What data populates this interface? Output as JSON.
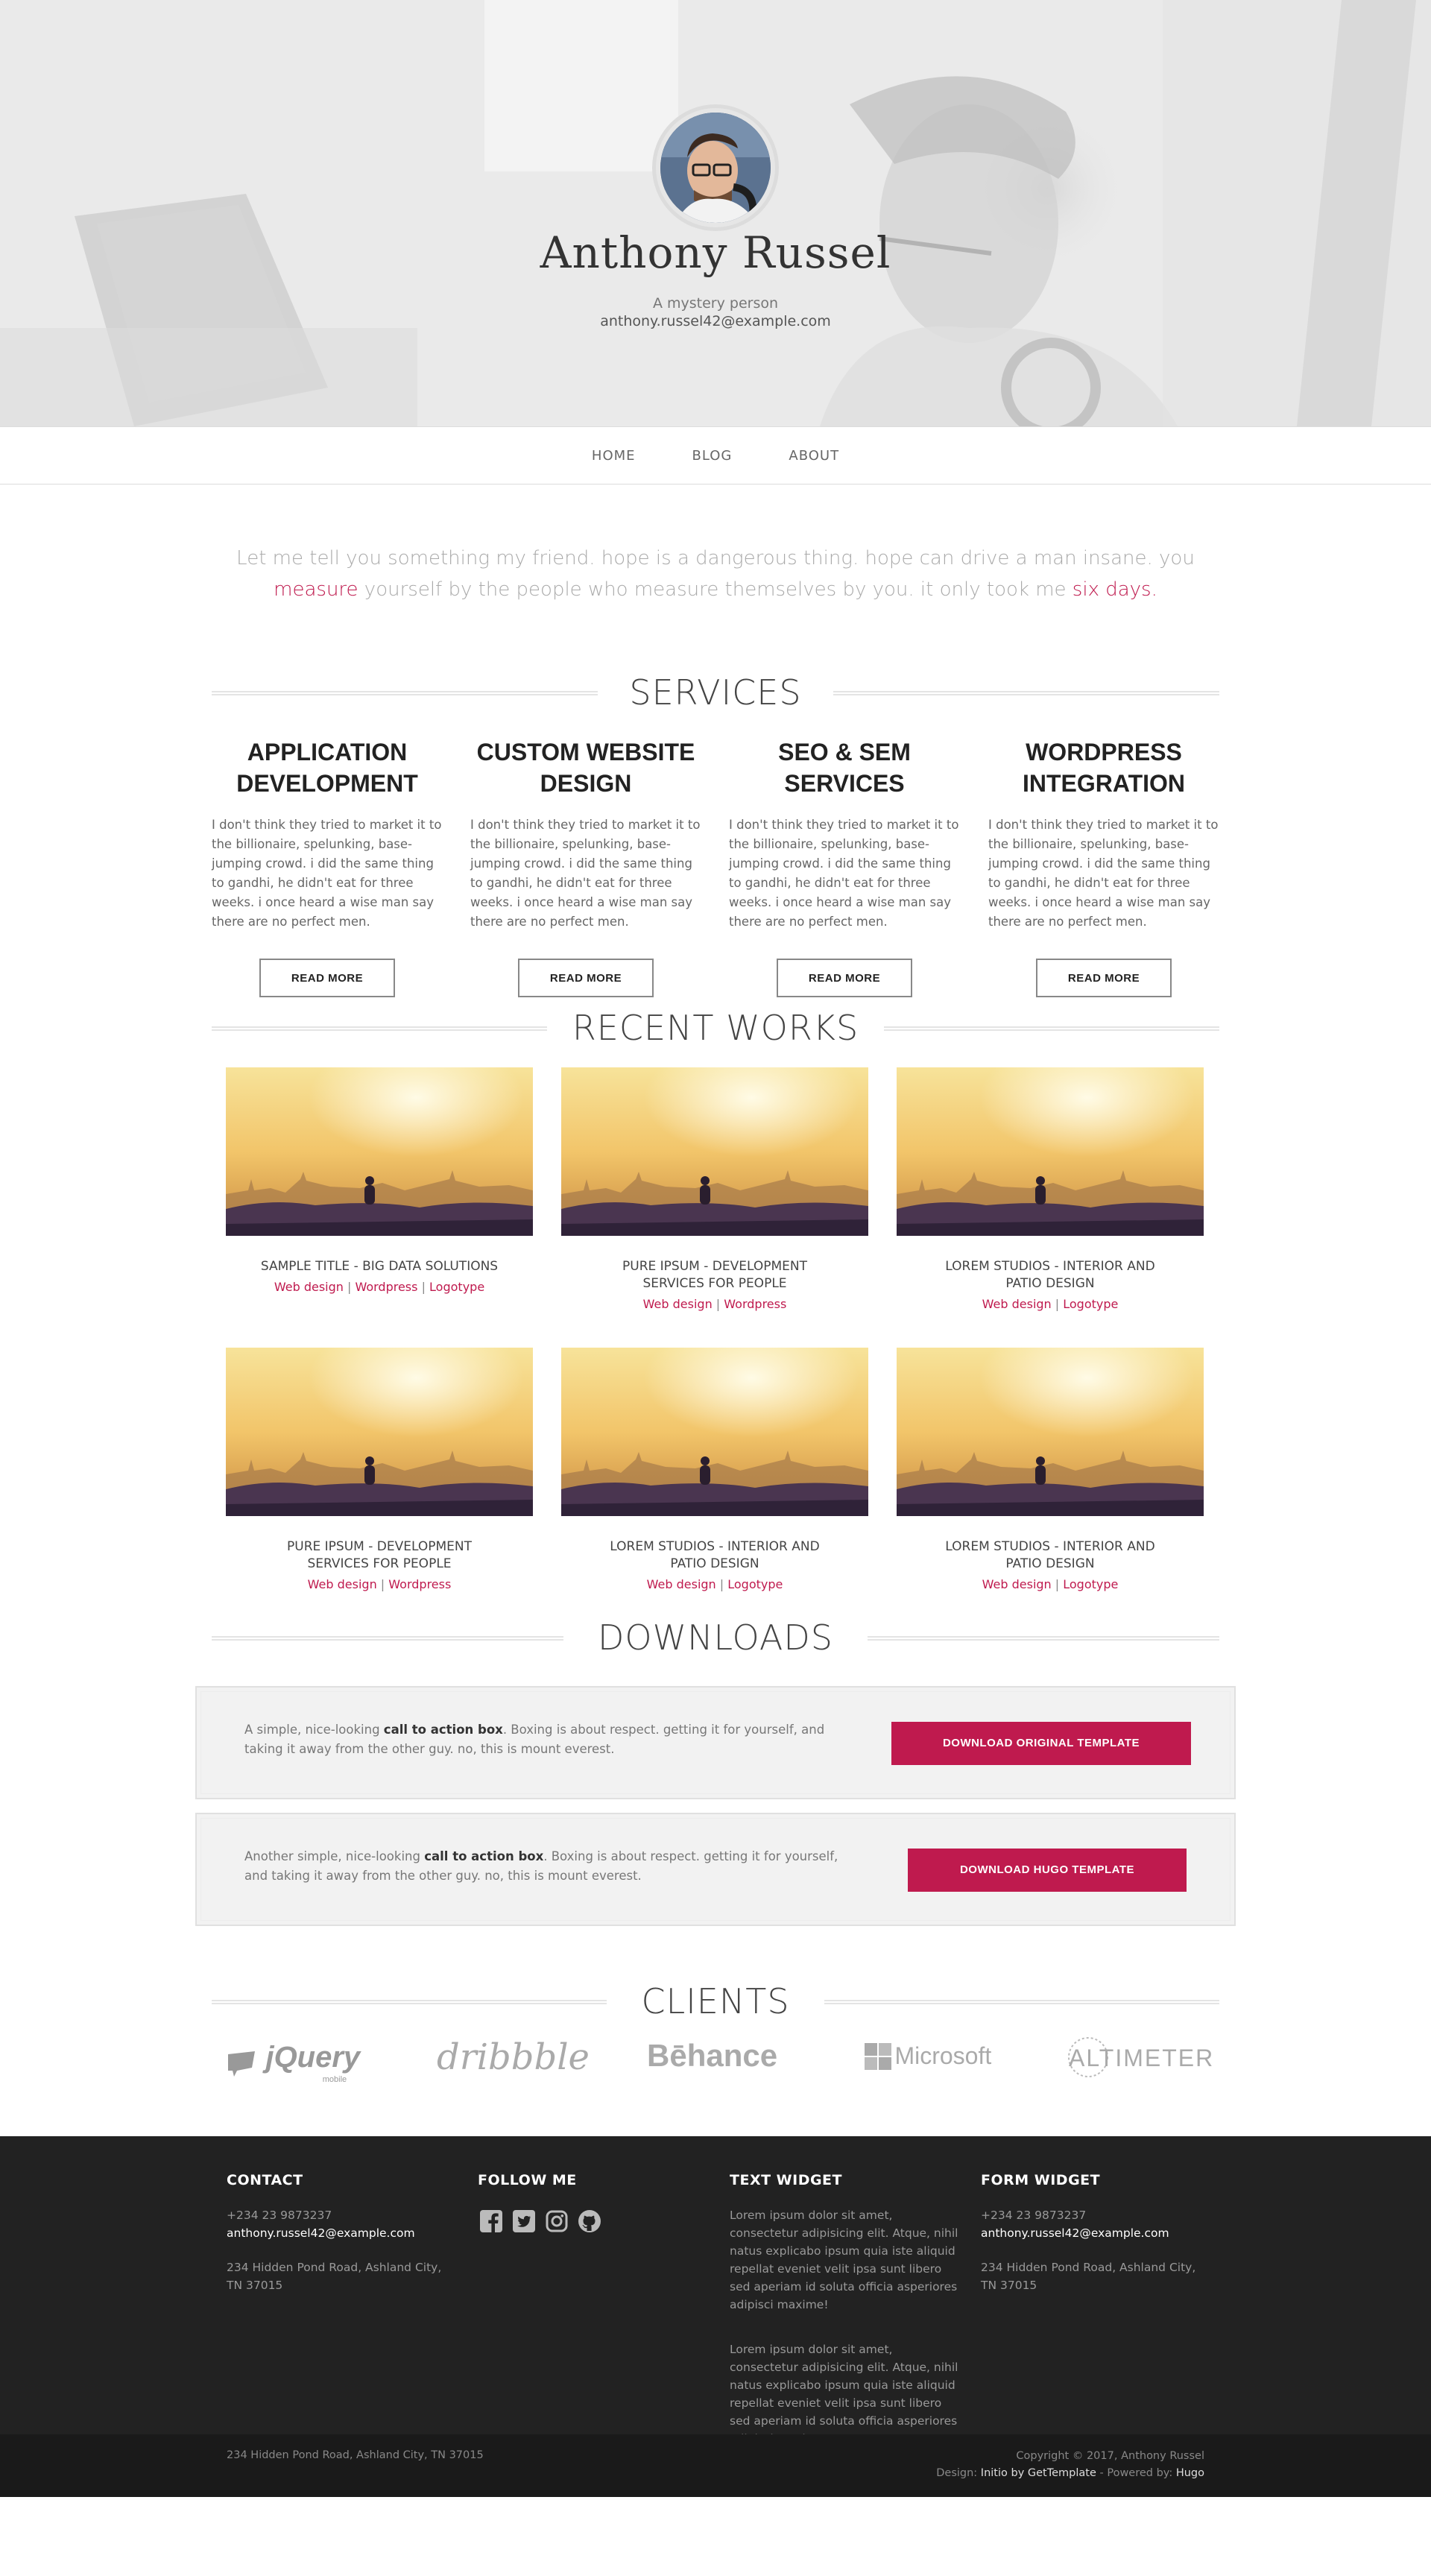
{
  "hero": {
    "name": "Anthony Russel",
    "tagline": "A mystery person",
    "email": "anthony.russel42@example.com"
  },
  "nav": {
    "items": [
      {
        "label": "HOME"
      },
      {
        "label": "BLOG"
      },
      {
        "label": "ABOUT"
      }
    ]
  },
  "intro": {
    "part1": "Let me tell you something my friend. hope is a dangerous thing. hope can drive a man insane. you ",
    "link1": "measure",
    "part2": " yourself by the people who measure themselves by you. it only took me ",
    "link2": "six days",
    "part3": "."
  },
  "services": {
    "title": "SERVICES",
    "items": [
      {
        "title": "APPLICATION DEVELOPMENT",
        "text": "I don't think they tried to market it to the billionaire, spelunking, base-jumping crowd. i did the same thing to gandhi, he didn't eat for three weeks. i once heard a wise man say there are no perfect men.",
        "button": "READ MORE"
      },
      {
        "title": "CUSTOM WEBSITE DESIGN",
        "text": "I don't think they tried to market it to the billionaire, spelunking, base-jumping crowd. i did the same thing to gandhi, he didn't eat for three weeks. i once heard a wise man say there are no perfect men.",
        "button": "READ MORE"
      },
      {
        "title": "SEO & SEM SERVICES",
        "text": "I don't think they tried to market it to the billionaire, spelunking, base-jumping crowd. i did the same thing to gandhi, he didn't eat for three weeks. i once heard a wise man say there are no perfect men.",
        "button": "READ MORE"
      },
      {
        "title": "WORDPRESS INTEGRATION",
        "text": "I don't think they tried to market it to the billionaire, spelunking, base-jumping crowd. i did the same thing to gandhi, he didn't eat for three weeks. i once heard a wise man say there are no perfect men.",
        "button": "READ MORE"
      }
    ]
  },
  "works": {
    "title": "RECENT WORKS",
    "items": [
      {
        "title": "SAMPLE TITLE - BIG DATA SOLUTIONS",
        "tags": [
          "Web design",
          "Wordpress",
          "Logotype"
        ]
      },
      {
        "title": "PURE IPSUM - DEVELOPMENT SERVICES FOR PEOPLE",
        "tags": [
          "Web design",
          "Wordpress"
        ]
      },
      {
        "title": "LOREM STUDIOS - INTERIOR AND PATIO DESIGN",
        "tags": [
          "Web design",
          "Logotype"
        ]
      },
      {
        "title": "PURE IPSUM - DEVELOPMENT SERVICES FOR PEOPLE",
        "tags": [
          "Web design",
          "Wordpress"
        ]
      },
      {
        "title": "LOREM STUDIOS - INTERIOR AND PATIO DESIGN",
        "tags": [
          "Web design",
          "Logotype"
        ]
      },
      {
        "title": "LOREM STUDIOS - INTERIOR AND PATIO DESIGN",
        "tags": [
          "Web design",
          "Logotype"
        ]
      }
    ]
  },
  "downloads": {
    "title": "DOWNLOADS",
    "boxes": [
      {
        "pre": "A simple, nice-looking ",
        "bold": "call to action box",
        "post": ". Boxing is about respect. getting it for yourself, and taking it away from the other guy. no, this is mount everest.",
        "button": "DOWNLOAD ORIGINAL TEMPLATE"
      },
      {
        "pre": "Another simple, nice-looking ",
        "bold": "call to action box",
        "post": ". Boxing is about respect. getting it for yourself, and taking it away from the other guy. no, this is mount everest.",
        "button": "DOWNLOAD HUGO TEMPLATE"
      }
    ]
  },
  "clients": {
    "title": "CLIENTS",
    "logos": [
      {
        "main": "jQuery",
        "sub": "mobile",
        "icon": "jquery-mobile-logo"
      },
      {
        "main": "dribbble",
        "icon": "dribbble-logo"
      },
      {
        "main": "Bēhance",
        "icon": "behance-logo"
      },
      {
        "main": "Microsoft",
        "icon": "microsoft-logo"
      },
      {
        "main": "ALTIMETER",
        "icon": "altimeter-logo"
      }
    ]
  },
  "footer": {
    "contact": {
      "heading": "CONTACT",
      "phone": "+234 23 9873237",
      "email": "anthony.russel42@example.com",
      "address": "234 Hidden Pond Road, Ashland City, TN 37015"
    },
    "follow": {
      "heading": "FOLLOW ME",
      "icons": [
        "facebook-icon",
        "twitter-icon",
        "instagram-icon",
        "github-icon"
      ]
    },
    "text_widget": {
      "heading": "TEXT WIDGET",
      "paragraphs": [
        "Lorem ipsum dolor sit amet, consectetur adipisicing elit. Atque, nihil natus explicabo ipsum quia iste aliquid repellat eveniet velit ipsa sunt libero sed aperiam id soluta officia asperiores adipisci maxime!",
        "Lorem ipsum dolor sit amet, consectetur adipisicing elit. Atque, nihil natus explicabo ipsum quia iste aliquid repellat eveniet velit ipsa sunt libero sed aperiam id soluta officia asperiores adipisci maxime!"
      ]
    },
    "form_widget": {
      "heading": "FORM WIDGET",
      "phone": "+234 23 9873237",
      "email": "anthony.russel42@example.com",
      "address": "234 Hidden Pond Road, Ashland City, TN 37015"
    }
  },
  "subfooter": {
    "address": "234 Hidden Pond Road, Ashland City, TN 37015",
    "copyright": "Copyright © 2017, Anthony Russel",
    "design_label": "Design: ",
    "design_link": "Initio by GetTemplate",
    "powered_label": " - Powered by: ",
    "powered_link": "Hugo"
  },
  "colors": {
    "accent": "#bf1a4e",
    "footer_bg": "#222222",
    "subfooter_bg": "#1a1a1a"
  }
}
